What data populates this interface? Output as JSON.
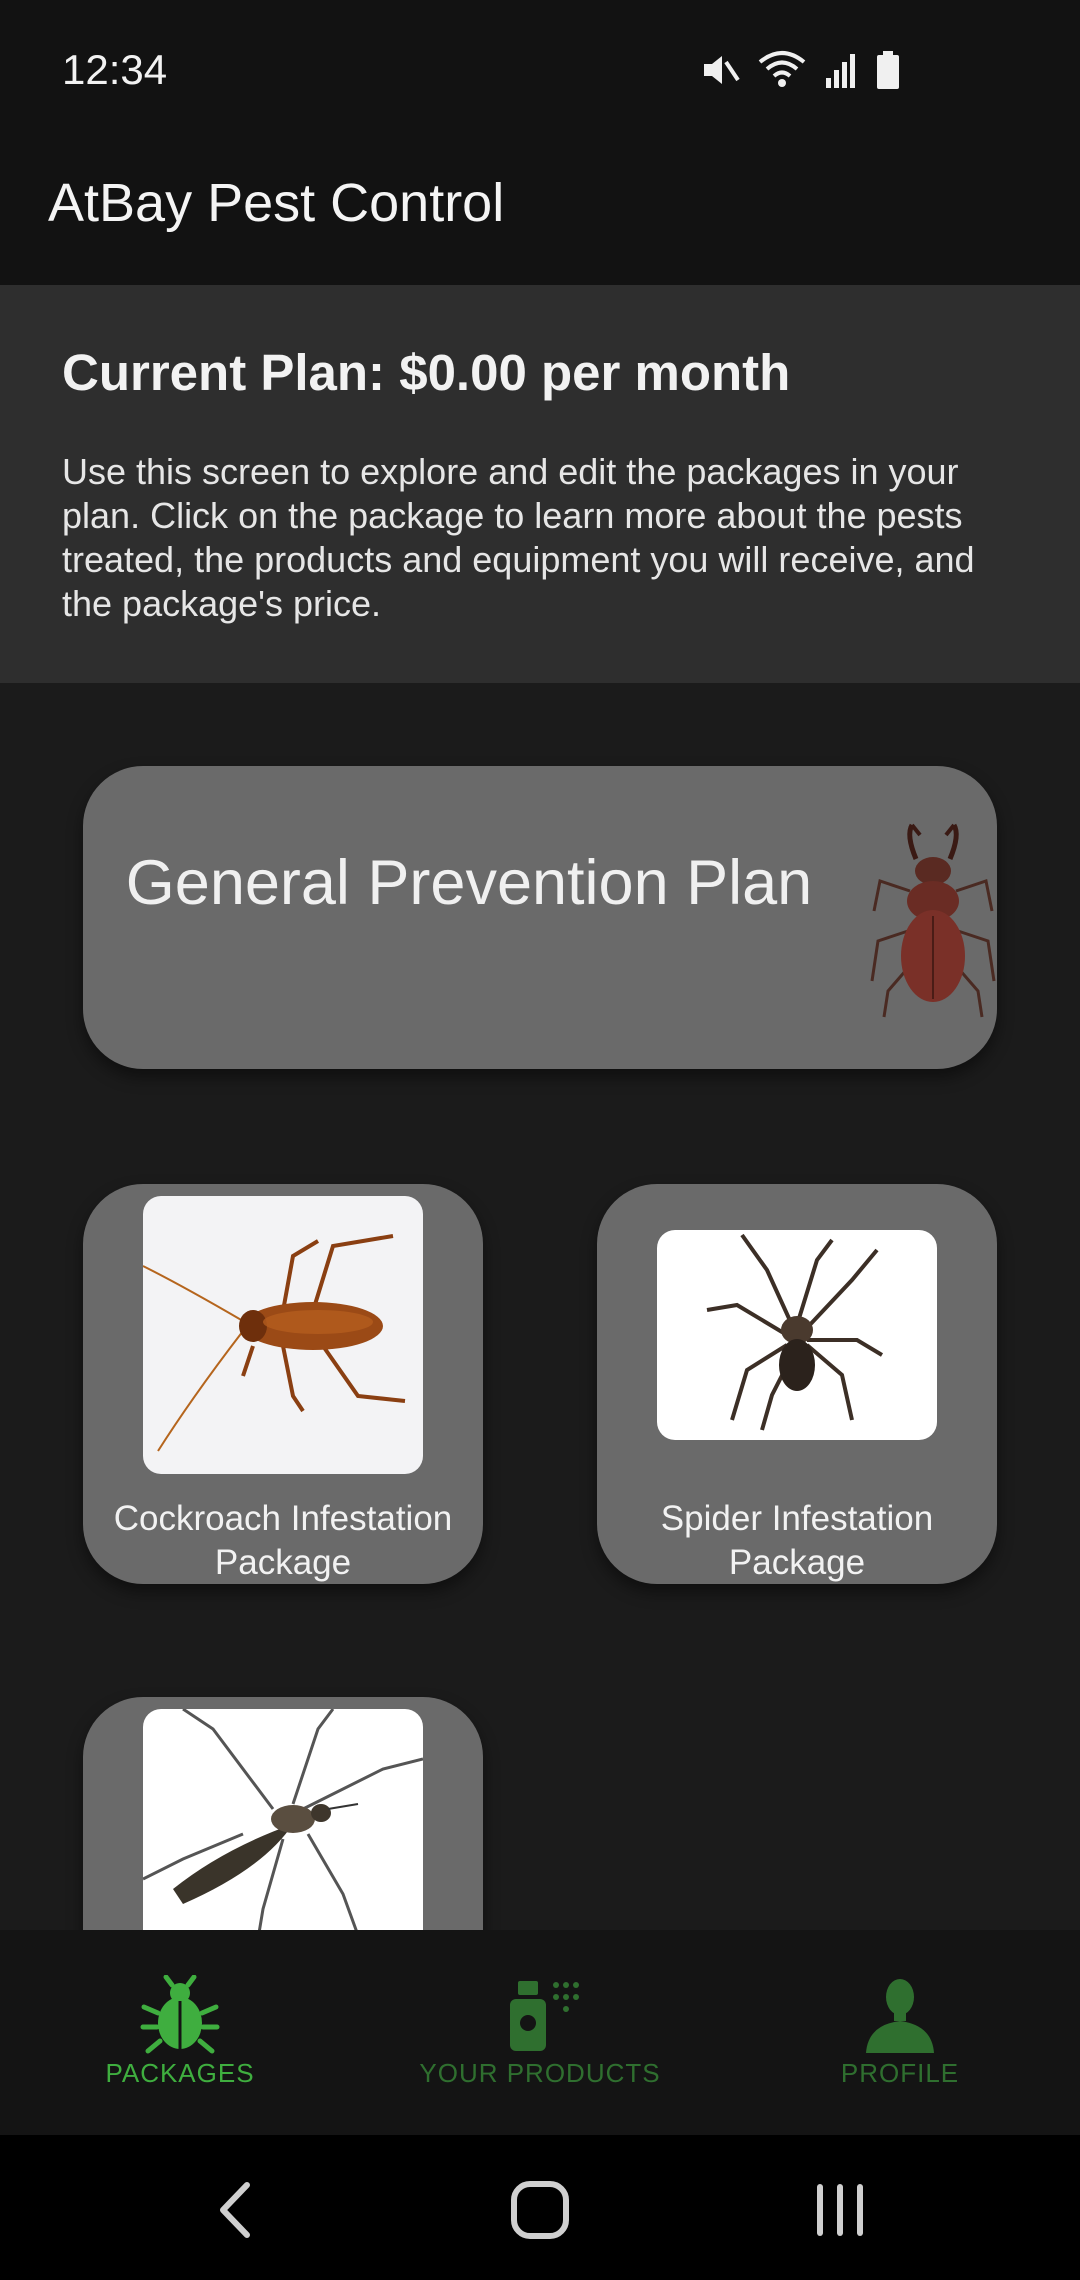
{
  "status_bar": {
    "time": "12:34",
    "icons": [
      "mute-icon",
      "wifi-icon",
      "signal-icon",
      "battery-icon"
    ]
  },
  "app_bar": {
    "title": "AtBay Pest Control"
  },
  "plan": {
    "title": "Current Plan: $0.00 per month",
    "description": "Use this screen to explore and edit the packages in your plan. Click on the package to learn more about the pests treated, the products and equipment you will receive, and the package's price."
  },
  "packages": {
    "general": {
      "label": "General Prevention Plan",
      "image": "stag-beetle-image"
    },
    "items": [
      {
        "label": "Cockroach Infestation Package",
        "image": "cockroach-image"
      },
      {
        "label": "Spider Infestation Package",
        "image": "spider-image"
      },
      {
        "label": "",
        "image": "mosquito-image"
      }
    ]
  },
  "bottom_nav": {
    "items": [
      {
        "label": "PACKAGES",
        "icon": "bug-icon",
        "active": true
      },
      {
        "label": "YOUR PRODUCTS",
        "icon": "spray-icon",
        "active": false
      },
      {
        "label": "PROFILE",
        "icon": "person-icon",
        "active": false
      }
    ]
  },
  "colors": {
    "accent_active": "#3fae3f",
    "accent_inactive": "#2f6f2f",
    "card": "#6a6a6a",
    "background": "#1b1b1b"
  }
}
